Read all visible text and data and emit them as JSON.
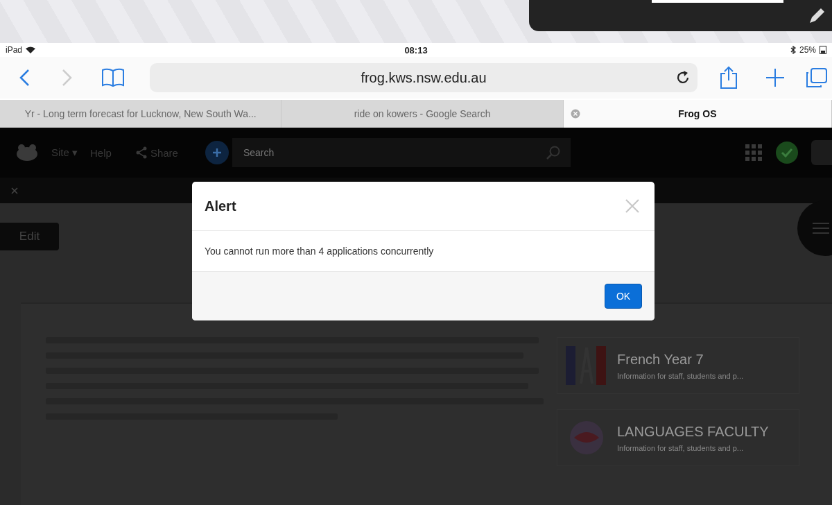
{
  "status_bar": {
    "device": "iPad",
    "time": "08:13",
    "battery": "25%"
  },
  "address_bar": {
    "url": "frog.kws.nsw.edu.au"
  },
  "tabs": [
    {
      "title": "Yr - Long term forecast for Lucknow, New South Wa...",
      "selected": false
    },
    {
      "title": "ride on kowers - Google Search",
      "selected": false
    },
    {
      "title": "Frog OS",
      "selected": true
    }
  ],
  "app_toolbar": {
    "site": "Site",
    "site_caret": "▾",
    "help": "Help",
    "share": "Share",
    "search_placeholder": "Search"
  },
  "edit_button": "Edit",
  "cards": [
    {
      "title": "French Year 7",
      "subtitle": "Information for staff, students and p...",
      "kind": "flag"
    },
    {
      "title": "LANGUAGES FACULTY",
      "subtitle": "Information for staff, students and p...",
      "kind": "globe"
    }
  ],
  "alert": {
    "title": "Alert",
    "message": "You cannot run more than 4 applications concurrently",
    "button": "OK"
  }
}
